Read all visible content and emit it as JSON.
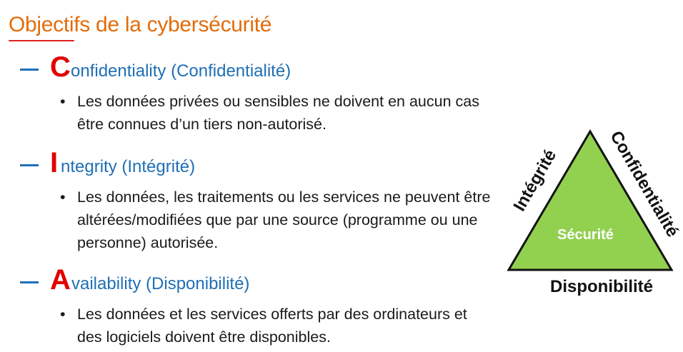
{
  "title": "Objectifs de la cybersécurité",
  "accent_color": "#E36C0A",
  "pillars": [
    {
      "initial": "C",
      "rest": "onfidentiality (Confidentialité)",
      "bullet_lines": [
        "Les données privées ou sensibles ne doivent en aucun cas",
        "être connues d’un tiers non-autorisé."
      ]
    },
    {
      "initial": "I",
      "rest": "ntegrity (Intégrité)",
      "bullet_lines": [
        "Les données, les traitements ou les services ne peuvent être",
        "altérées/modifiées que par une source (programme ou une",
        "personne) autorisée."
      ]
    },
    {
      "initial": "A",
      "rest": "vailability (Disponibilité)",
      "bullet_lines": [
        "Les données et les services offerts par des ordinateurs et",
        "des logiciels doivent être disponibles."
      ]
    }
  ],
  "bullet_symbol": "•",
  "triangle": {
    "fill_color": "#92D050",
    "left_label": "Intégrité",
    "right_label": "Confidentialité",
    "bottom_label": "Disponibilité",
    "center_label": "Sécurité"
  }
}
